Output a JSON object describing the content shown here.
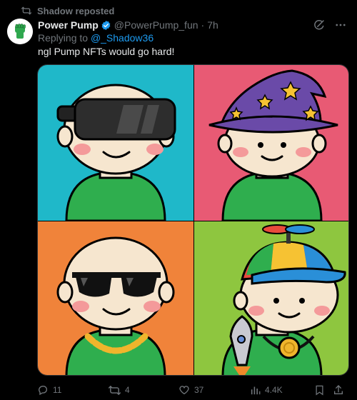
{
  "repost": {
    "label": "Shadow reposted"
  },
  "tweet": {
    "display_name": "Power Pump",
    "handle": "@PowerPump_fun",
    "separator": "·",
    "time": "7h",
    "replying_prefix": "Replying to",
    "replying_to": "@_Shadow36",
    "text": "ngl Pump NFTs would go hard!"
  },
  "media": {
    "tiles": [
      {
        "bg": "#1fb8c9",
        "accessory": "vr-headset"
      },
      {
        "bg": "#e85a74",
        "accessory": "wizard-hat"
      },
      {
        "bg": "#f0833a",
        "accessory": "sunglasses-chain"
      },
      {
        "bg": "#8ec63f",
        "accessory": "propeller-cap-rocket"
      }
    ]
  },
  "actions": {
    "replies": "11",
    "reposts": "4",
    "likes": "37",
    "views": "4.4K"
  },
  "colors": {
    "accent": "#1d9bf0",
    "repost_green": "#00ba7c",
    "muted": "#71767b"
  }
}
